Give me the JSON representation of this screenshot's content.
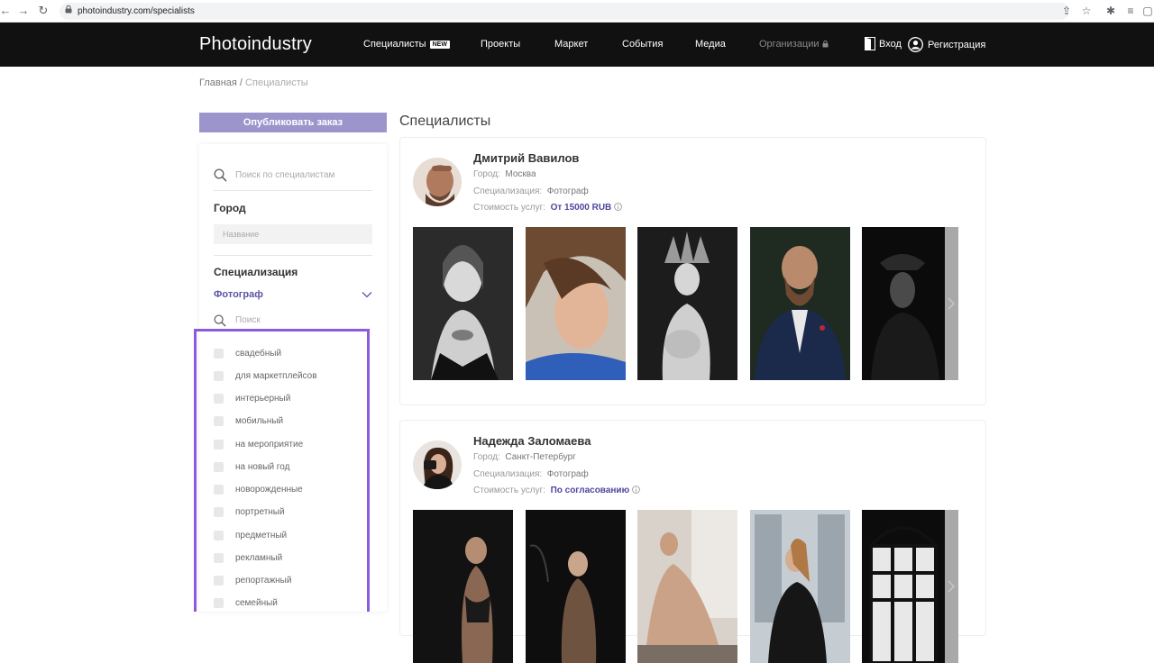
{
  "browser": {
    "url": "photoindustry.com/specialists"
  },
  "header": {
    "logo": "Photoindustry",
    "nav": [
      {
        "label": "Специалисты",
        "badge": "NEW"
      },
      {
        "label": "Проекты"
      },
      {
        "label": "Маркет"
      },
      {
        "label": "События"
      },
      {
        "label": "Медиа"
      },
      {
        "label": "Организации",
        "locked": true
      }
    ],
    "login_label": "Вход",
    "register_label": "Регистрация",
    "background": "#111111"
  },
  "breadcrumb": {
    "home": "Главная",
    "separator": " / ",
    "current": "Специалисты"
  },
  "sidebar": {
    "publish_button": "Опубликовать заказ",
    "search_placeholder": "Поиск по специалистам",
    "city_title": "Город",
    "city_placeholder": "Название",
    "spec_title": "Специализация",
    "spec_selected": "Фотограф",
    "spec_search_placeholder": "Поиск",
    "subcategories": [
      "свадебный",
      "для маркетплейсов",
      "интерьерный",
      "мобильный",
      "на мероприятие",
      "на новый год",
      "новорожденные",
      "портретный",
      "предметный",
      "рекламный",
      "репортажный",
      "семейный"
    ],
    "accent": "#9b95cc",
    "highlight_color": "#8b5bdc"
  },
  "main": {
    "title": "Специалисты",
    "labels": {
      "city": "Город:",
      "specialization": "Специализация:",
      "price": "Стоимость услуг:"
    },
    "specialists": [
      {
        "name": "Дмитрий Вавилов",
        "city": "Москва",
        "specialization": "Фотограф",
        "price": "От 15000 RUB"
      },
      {
        "name": "Надежда Заломаева",
        "city": "Санкт-Петербург",
        "specialization": "Фотограф",
        "price": "По согласованию"
      }
    ],
    "price_color": "#4e479e"
  }
}
